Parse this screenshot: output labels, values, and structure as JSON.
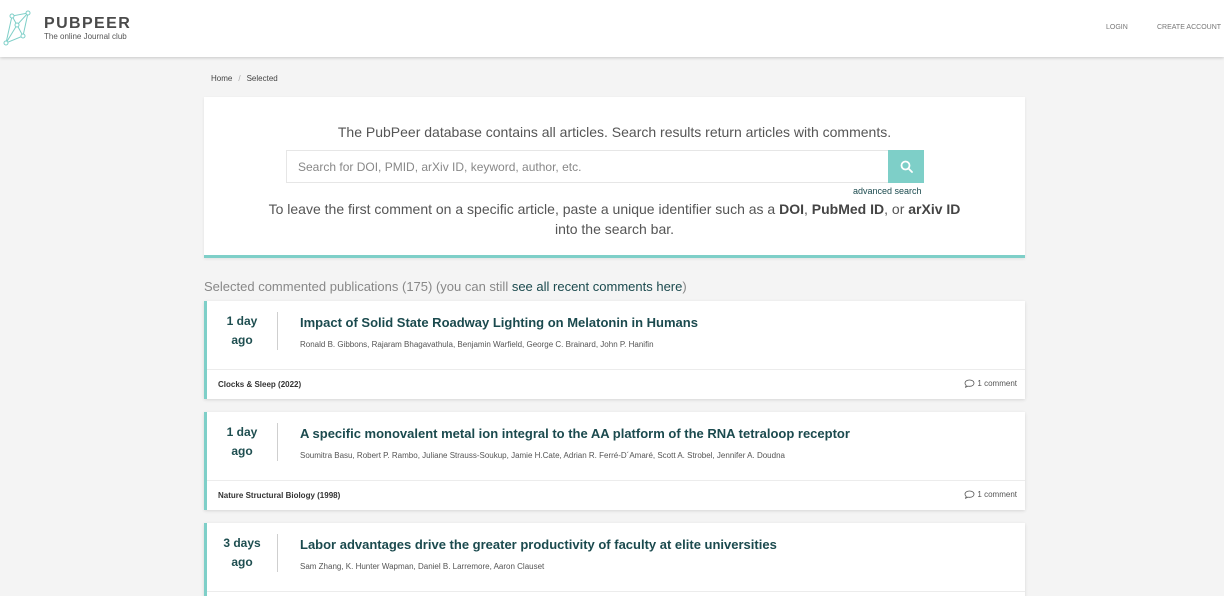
{
  "header": {
    "brand": "PUBPEER",
    "tagline": "The online Journal club",
    "nav": {
      "login": "LOGIN",
      "create_account": "CREATE ACCOUNT"
    }
  },
  "breadcrumb": {
    "home": "Home",
    "separator": "/",
    "current": "Selected"
  },
  "search": {
    "intro": "The PubPeer database contains all articles. Search results return articles with comments.",
    "placeholder": "Search for DOI, PMID, arXiv ID, keyword, author, etc.",
    "value": "",
    "advanced": "advanced search",
    "help_pre": "To leave the first comment on a specific article, paste a unique identifier such as a ",
    "help_doi": "DOI",
    "help_comma": ", ",
    "help_pubmed": "PubMed ID",
    "help_or": ", or ",
    "help_arxiv": "arXiv ID",
    "help_post": " into the search bar."
  },
  "list": {
    "heading_pre": "Selected commented publications (175) (you can still ",
    "heading_link": "see all recent comments here",
    "heading_post": ")"
  },
  "publications": [
    {
      "time_value": "1 day",
      "time_unit": "ago",
      "title": "Impact of Solid State Roadway Lighting on Melatonin in Humans",
      "authors": "Ronald B. Gibbons, Rajaram Bhagavathula, Benjamin Warfield, George C. Brainard, John P. Hanifin",
      "journal": "Clocks & Sleep (2022)",
      "comments": "1 comment"
    },
    {
      "time_value": "1 day",
      "time_unit": "ago",
      "title": "A specific monovalent metal ion integral to the AA platform of the RNA tetraloop receptor",
      "authors": "Soumitra Basu, Robert P. Rambo, Juliane Strauss-Soukup, Jamie H.Cate, Adrian R. Ferré-D´Amaré, Scott A. Strobel, Jennifer A. Doudna",
      "journal": "Nature Structural Biology (1998)",
      "comments": "1 comment"
    },
    {
      "time_value": "3 days",
      "time_unit": "ago",
      "title": "Labor advantages drive the greater productivity of faculty at elite universities",
      "authors": "Sam Zhang, K. Hunter Wapman, Daniel B. Larremore, Aaron Clauset",
      "journal": "",
      "comments": ""
    }
  ],
  "colors": {
    "accent": "#7ecfc8",
    "title": "#1b4a4e",
    "background": "#f4f4f4"
  },
  "icons": {
    "logo": "pubpeer-constellation-icon",
    "search": "search-icon",
    "comment": "comment-bubble-icon"
  }
}
